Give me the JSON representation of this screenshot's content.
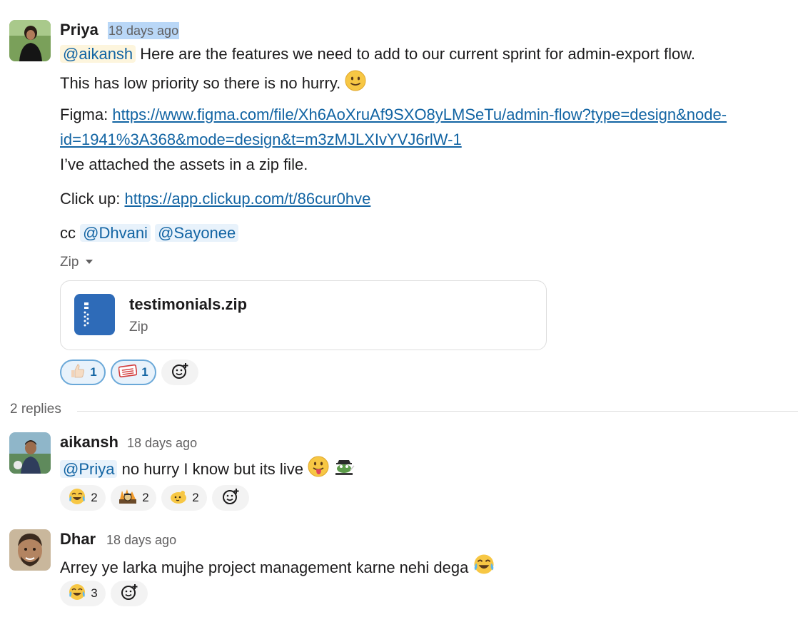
{
  "messages": [
    {
      "author": "Priya",
      "timestamp": "18 days ago",
      "mention_aikansh": "@aikansh",
      "line1_text": "Here are the features we need to add to our current sprint for admin-export flow.",
      "line2_text": "This has low priority so there is no hurry.",
      "figma_prefix": "Figma:",
      "figma_link_line1": "https://www.figma.com/file/Xh6AoXruAf9SXO8yLMSeTu/admin-flow?type=design&node-",
      "figma_link_line2": "id=1941%3A368&mode=design&t=m3zMJLXIvYVJ6rlW-1",
      "assets_text": "I’ve attached the assets in a zip file.",
      "clickup_prefix": "Click up:",
      "clickup_link": "https://app.clickup.com/t/86cur0hve",
      "cc_prefix": "cc",
      "cc_mention_1": "@Dhvani",
      "cc_mention_2": "@Sayonee",
      "attachment_group_label": "Zip",
      "attachment": {
        "filename": "testimonials.zip",
        "filetype": "Zip"
      },
      "reactions": [
        {
          "emoji": "thumbsup-light-skin",
          "count": "1"
        },
        {
          "emoji": "done-stamp",
          "count": "1"
        }
      ]
    }
  ],
  "thread": {
    "reply_count": "2 replies",
    "replies": [
      {
        "author": "aikansh",
        "timestamp": "18 days ago",
        "mention": "@Priya",
        "text": "no hurry I know but its live",
        "reactions": [
          {
            "emoji": "joy",
            "count": "2"
          },
          {
            "emoji": "this-is-fine",
            "count": "2"
          },
          {
            "emoji": "yellow-blob",
            "count": "2"
          }
        ]
      },
      {
        "author": "Dhar",
        "timestamp": "18 days ago",
        "text": "Arrey ye larka mujhe project management karne nehi dega",
        "reactions": [
          {
            "emoji": "joy",
            "count": "3"
          }
        ]
      }
    ]
  },
  "colors": {
    "link": "#1264a3",
    "mention_bg": "#e8f2fb",
    "self_mention_bg": "#fdf5dd",
    "timestamp_selection": "#b9d7f7",
    "active_reaction_border": "#6aa8d8"
  }
}
